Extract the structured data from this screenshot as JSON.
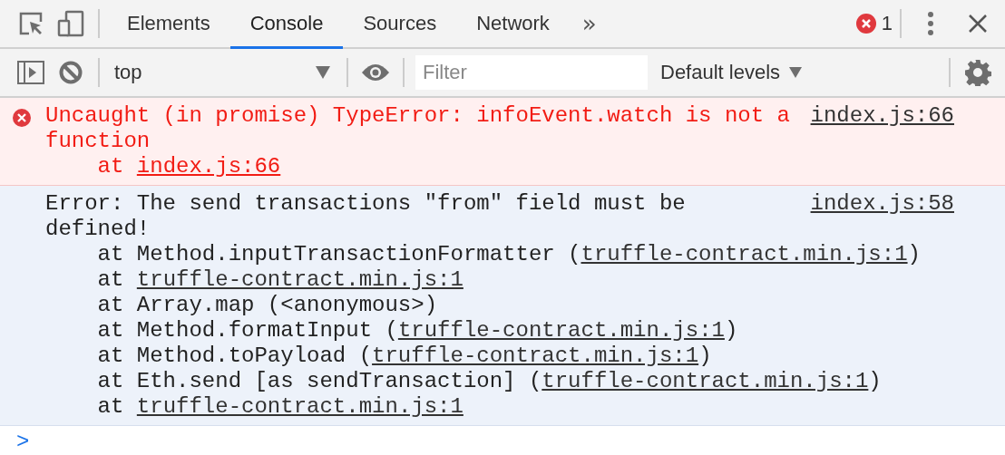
{
  "tabs": [
    {
      "label": "Elements",
      "selected": false
    },
    {
      "label": "Console",
      "selected": true
    },
    {
      "label": "Sources",
      "selected": false
    },
    {
      "label": "Network",
      "selected": false
    }
  ],
  "more_tabs": "»",
  "error_count": "1",
  "context": "top",
  "filter": {
    "placeholder": "Filter"
  },
  "levels": "Default levels",
  "messages": [
    {
      "kind": "error",
      "text": "Uncaught (in promise) TypeError: infoEvent.watch is not a function",
      "source": "index.js:66",
      "stack": [
        {
          "prefix": "at ",
          "link": "index.js:66"
        }
      ]
    },
    {
      "kind": "info",
      "text": "Error: The send transactions \"from\" field must be defined!",
      "source": "index.js:58",
      "stack": [
        {
          "prefix": "at Method.inputTransactionFormatter (",
          "link": "truffle-contract.min.js:1",
          "suffix": ")"
        },
        {
          "prefix": "at ",
          "link": "truffle-contract.min.js:1"
        },
        {
          "prefix": "at Array.map (<anonymous>)"
        },
        {
          "prefix": "at Method.formatInput (",
          "link": "truffle-contract.min.js:1",
          "suffix": ")"
        },
        {
          "prefix": "at Method.toPayload (",
          "link": "truffle-contract.min.js:1",
          "suffix": ")"
        },
        {
          "prefix": "at Eth.send [as sendTransaction] (",
          "link": "truffle-contract.min.js:1",
          "suffix": ")"
        },
        {
          "prefix": "at ",
          "link": "truffle-contract.min.js:1"
        }
      ]
    }
  ],
  "prompt": ">"
}
